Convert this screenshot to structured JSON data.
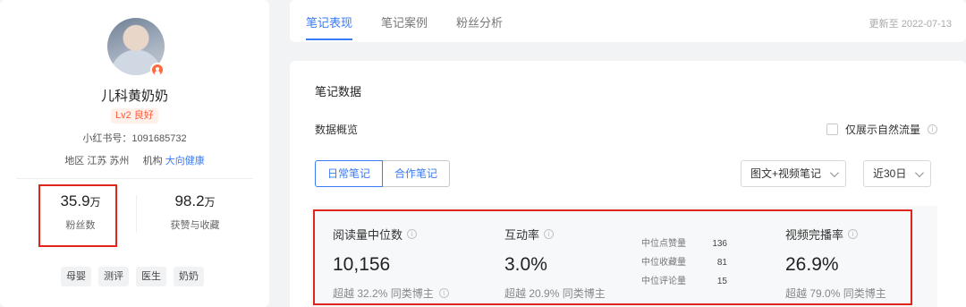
{
  "profile": {
    "nickname": "儿科黄奶奶",
    "level": "Lv2 良好",
    "redbook_id": "小红书号：1091685732",
    "region_label": "地区",
    "region_value": "江苏 苏州",
    "org_label": "机构",
    "org_value": "大向健康",
    "followers": {
      "value": "35.9",
      "unit": "万",
      "label": "粉丝数"
    },
    "likes": {
      "value": "98.2",
      "unit": "万",
      "label": "获赞与收藏"
    },
    "tags": [
      "母婴",
      "测评",
      "医生",
      "奶奶"
    ],
    "highlight_color": "#e0261c"
  },
  "tabs": [
    {
      "label": "笔记表现",
      "active": true
    },
    {
      "label": "笔记案例",
      "active": false
    },
    {
      "label": "粉丝分析",
      "active": false
    }
  ],
  "updated": "更新至 2022-07-13",
  "content": {
    "section_title": "笔记数据",
    "overview_title": "数据概览",
    "natural_only_label": "仅展示自然流量",
    "segments": [
      "日常笔记",
      "合作笔记"
    ],
    "note_type_select": "图文+视频笔记",
    "range_select": "近30日",
    "metrics": {
      "read": {
        "label": "阅读量中位数",
        "value": "10,156",
        "sub": "超越 32.2% 同类博主"
      },
      "engage": {
        "label": "互动率",
        "value": "3.0%",
        "sub": "超越 20.9% 同类博主"
      },
      "video": {
        "label": "视频完播率",
        "value": "26.9%",
        "sub": "超越 79.0% 同类博主"
      }
    },
    "mini_stats": [
      {
        "label": "中位点赞量",
        "value": "136"
      },
      {
        "label": "中位收藏量",
        "value": "81"
      },
      {
        "label": "中位评论量",
        "value": "15"
      }
    ]
  },
  "accent_color": "#3a7bf5"
}
